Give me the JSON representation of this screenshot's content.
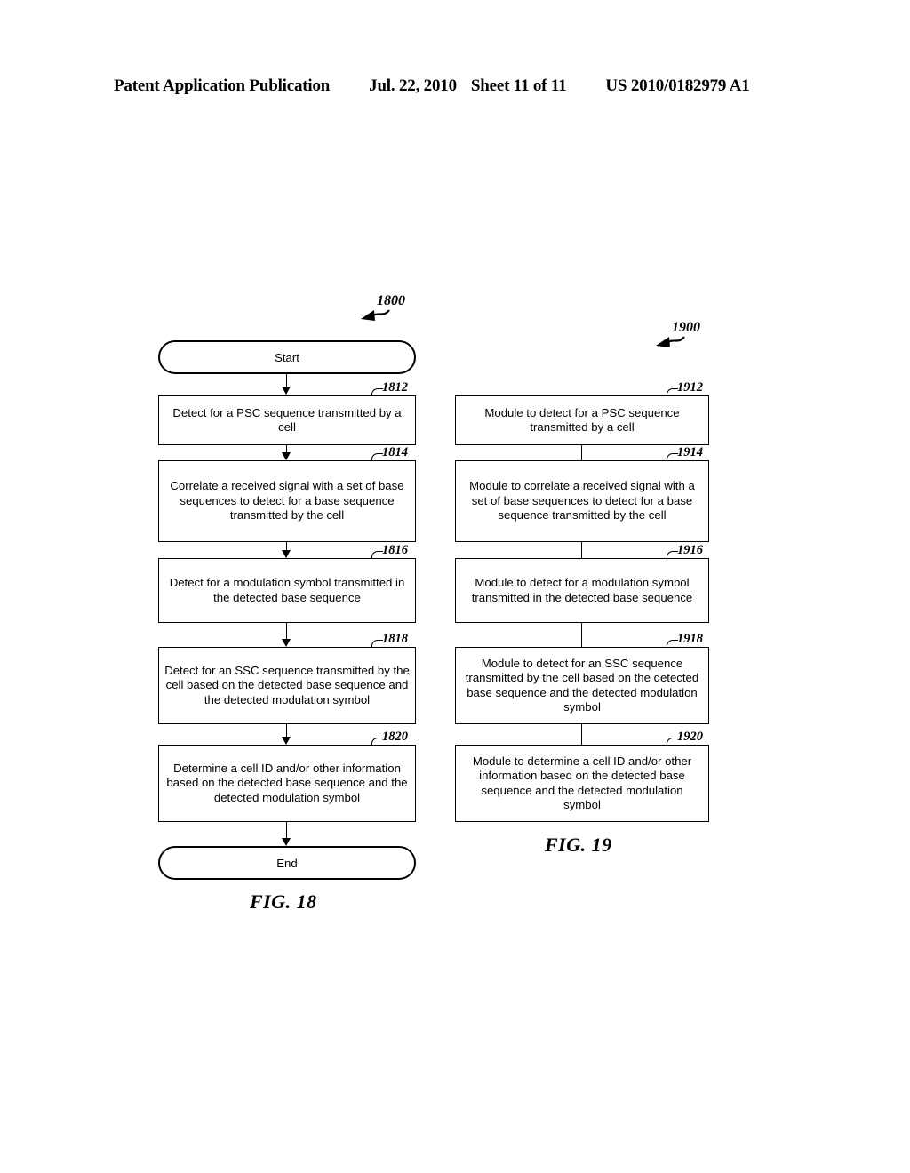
{
  "header": {
    "publication": "Patent Application Publication",
    "date": "Jul. 22, 2010",
    "sheet": "Sheet 11 of 11",
    "number": "US 2010/0182979 A1"
  },
  "figures": [
    {
      "id": "fig18",
      "caption": "FIG. 18",
      "figure_number": "1800",
      "type": "flowchart",
      "start_label": "Start",
      "end_label": "End",
      "connector_style": "arrow",
      "steps": [
        {
          "ref": "1812",
          "text": "Detect for a PSC sequence transmitted by a cell"
        },
        {
          "ref": "1814",
          "text": "Correlate a received signal with a set of base sequences to detect for a base sequence transmitted by the cell"
        },
        {
          "ref": "1816",
          "text": "Detect for a modulation symbol transmitted in the detected base sequence"
        },
        {
          "ref": "1818",
          "text": "Detect for an SSC sequence transmitted by the cell based on the detected base sequence and the detected modulation symbol"
        },
        {
          "ref": "1820",
          "text": "Determine a cell ID and/or other information based on the detected base sequence and the detected modulation symbol"
        }
      ]
    },
    {
      "id": "fig19",
      "caption": "FIG. 19",
      "figure_number": "1900",
      "type": "module-block-diagram",
      "connector_style": "line",
      "steps": [
        {
          "ref": "1912",
          "text": "Module to detect for a PSC sequence transmitted by a cell"
        },
        {
          "ref": "1914",
          "text": "Module to correlate a received signal with a set of base sequences to detect for a base sequence transmitted by the cell"
        },
        {
          "ref": "1916",
          "text": "Module to detect for a modulation symbol transmitted in the detected base sequence"
        },
        {
          "ref": "1918",
          "text": "Module to detect for an SSC sequence transmitted by the cell based on the detected base sequence and the detected modulation symbol"
        },
        {
          "ref": "1920",
          "text": "Module to determine a cell ID and/or other information based on the detected base sequence and the detected modulation symbol"
        }
      ]
    }
  ],
  "colors": {
    "ink": "#000000",
    "paper": "#ffffff"
  }
}
